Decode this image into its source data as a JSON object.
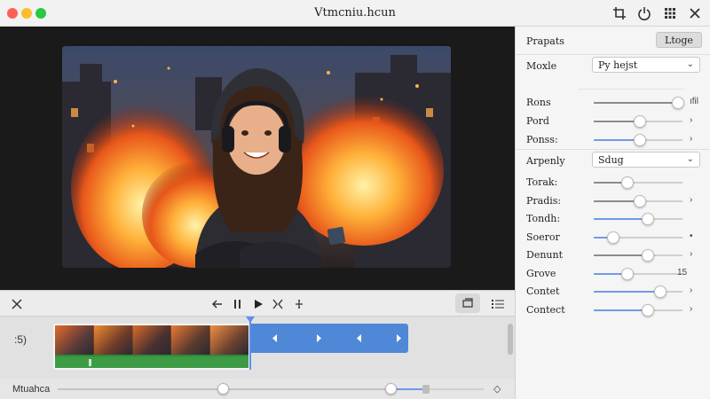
{
  "window": {
    "title": "Vtmcniu.hcun"
  },
  "toolbar_icons": [
    "crop-icon",
    "power-icon",
    "grid-icon",
    "close-icon"
  ],
  "transport": {
    "buttons": [
      "close-icon",
      "rewind-icon",
      "pause-icon",
      "play-icon",
      "split-icon",
      "add-icon"
    ],
    "right_buttons": [
      "stack-icon",
      "list-icon"
    ]
  },
  "timeline": {
    "track_label": ":5)"
  },
  "bottom": {
    "label": "Mtuahca",
    "zoom_value": 0.49
  },
  "inspector": {
    "header_label": "Prapats",
    "header_button": "Ltoge",
    "mode_label": "Moxle",
    "mode_value": "Py hejst",
    "aspect_label": "Arpenly",
    "aspect_value": "Sdug",
    "sliders_top": [
      {
        "label": "Rons",
        "value": 0.95,
        "color": "grey",
        "extra": "ıfil"
      },
      {
        "label": "Pord",
        "value": 0.52,
        "color": "grey",
        "extra": "›"
      },
      {
        "label": "Ponss:",
        "value": 0.52,
        "color": "blue",
        "extra": "›"
      }
    ],
    "sliders_bottom": [
      {
        "label": "Torak:",
        "value": 0.38,
        "color": "grey",
        "extra": ""
      },
      {
        "label": "Pradis:",
        "value": 0.52,
        "color": "grey",
        "extra": "›"
      },
      {
        "label": "Tondh:",
        "value": 0.61,
        "color": "blue",
        "extra": ""
      },
      {
        "label": "Soeror",
        "value": 0.22,
        "color": "blue",
        "extra": "•"
      },
      {
        "label": "Denunt",
        "value": 0.61,
        "color": "grey",
        "extra": "›"
      },
      {
        "label": "Grove",
        "value": 0.38,
        "color": "blue",
        "extra": "15"
      },
      {
        "label": "Contet",
        "value": 0.75,
        "color": "blue",
        "extra": "›"
      },
      {
        "label": "Contect",
        "value": 0.61,
        "color": "blue",
        "extra": "›"
      }
    ]
  }
}
